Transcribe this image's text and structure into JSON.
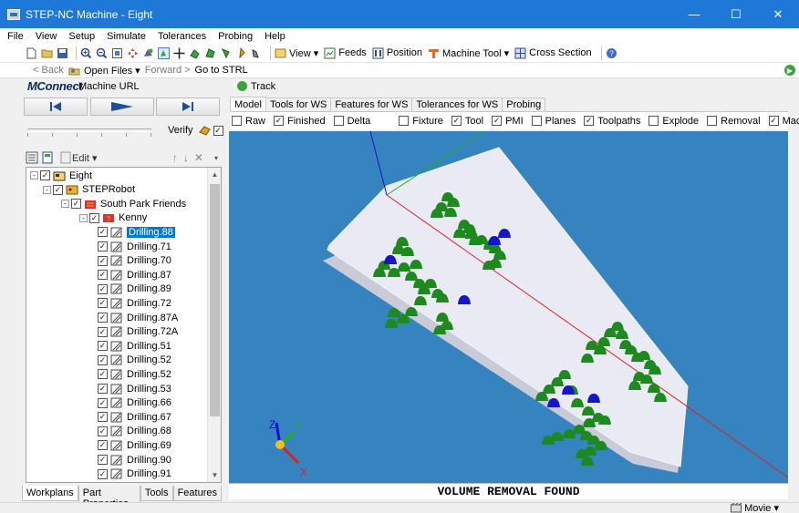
{
  "window": {
    "title": "STEP-NC Machine - Eight",
    "minimize": "—",
    "maximize": "☐",
    "close": "✕"
  },
  "menu": [
    "File",
    "View",
    "Setup",
    "Simulate",
    "Tolerances",
    "Probing",
    "Help"
  ],
  "toolbar": {
    "view_label": "View ▾",
    "feeds_label": "Feeds",
    "position_label": "Position",
    "machine_tool_label": "Machine Tool ▾",
    "cross_section_label": "Cross Section"
  },
  "nav": {
    "back": "< Back",
    "open_files": "Open Files ▾",
    "forward": "Forward >",
    "go_to_strl": "Go to STRL"
  },
  "mtconnect": {
    "logo_m": "M",
    "logo_rest": "Connect",
    "url_label": "Machine URL",
    "track": "Track"
  },
  "player": {
    "verify": "Verify"
  },
  "tree_toolbar": {
    "edit": "Edit ▾"
  },
  "tree": [
    {
      "label": "Eight",
      "indent": 0,
      "expander": "⊟",
      "checked": true,
      "icon": "workplan-icon"
    },
    {
      "label": "STEPRobot",
      "indent": 1,
      "expander": "⊟",
      "checked": true,
      "icon": "robot-icon"
    },
    {
      "label": "South Park Friends",
      "indent": 2,
      "expander": "⊟",
      "checked": true,
      "icon": "group-icon"
    },
    {
      "label": "Kenny",
      "indent": 3,
      "expander": "⊟",
      "checked": true,
      "icon": "setup-icon"
    },
    {
      "label": "Drilling.88",
      "indent": 4,
      "checked": true,
      "selected": true
    },
    {
      "label": "Drilling.71",
      "indent": 4,
      "checked": true
    },
    {
      "label": "Drilling.70",
      "indent": 4,
      "checked": true
    },
    {
      "label": "Drilling.87",
      "indent": 4,
      "checked": true
    },
    {
      "label": "Drilling.89",
      "indent": 4,
      "checked": true
    },
    {
      "label": "Drilling.72",
      "indent": 4,
      "checked": true
    },
    {
      "label": "Drilling.87A",
      "indent": 4,
      "checked": true
    },
    {
      "label": "Drilling.72A",
      "indent": 4,
      "checked": true
    },
    {
      "label": "Drilling.51",
      "indent": 4,
      "checked": true
    },
    {
      "label": "Drilling.52",
      "indent": 4,
      "checked": true
    },
    {
      "label": "Drilling.52",
      "indent": 4,
      "checked": true
    },
    {
      "label": "Drilling.53",
      "indent": 4,
      "checked": true
    },
    {
      "label": "Drilling.66",
      "indent": 4,
      "checked": true
    },
    {
      "label": "Drilling.67",
      "indent": 4,
      "checked": true
    },
    {
      "label": "Drilling.68",
      "indent": 4,
      "checked": true
    },
    {
      "label": "Drilling.69",
      "indent": 4,
      "checked": true
    },
    {
      "label": "Drilling.90",
      "indent": 4,
      "checked": true
    },
    {
      "label": "Drilling.91",
      "indent": 4,
      "checked": true
    }
  ],
  "left_tabs": [
    "Workplans",
    "Part Properties",
    "Tools",
    "Features"
  ],
  "right_tabs": [
    "Model",
    "Tools for WS",
    "Features for WS",
    "Tolerances for WS",
    "Probing"
  ],
  "options": [
    {
      "label": "Raw",
      "checked": false
    },
    {
      "label": "Finished",
      "checked": true
    },
    {
      "label": "Delta",
      "checked": false
    },
    {
      "label": "Fixture",
      "checked": false
    },
    {
      "label": "Tool",
      "checked": true
    },
    {
      "label": "PMI",
      "checked": true
    },
    {
      "label": "Planes",
      "checked": false
    },
    {
      "label": "Toolpaths",
      "checked": true
    },
    {
      "label": "Explode",
      "checked": false
    },
    {
      "label": "Removal",
      "checked": false
    },
    {
      "label": "Machine",
      "checked": true
    }
  ],
  "axes": {
    "x": "X",
    "y": "Y",
    "z": "Z"
  },
  "status_message": "VOLUME REMOVAL FOUND",
  "statusbar": {
    "movie": "Movie ▾"
  },
  "colors": {
    "titlebar": "#1e78d7",
    "viewport_bg": "#3584bf",
    "panel": "#e6e8f0",
    "dome_green": "#1d8a1d",
    "dome_blue": "#1515cc",
    "selection": "#0078d7"
  }
}
